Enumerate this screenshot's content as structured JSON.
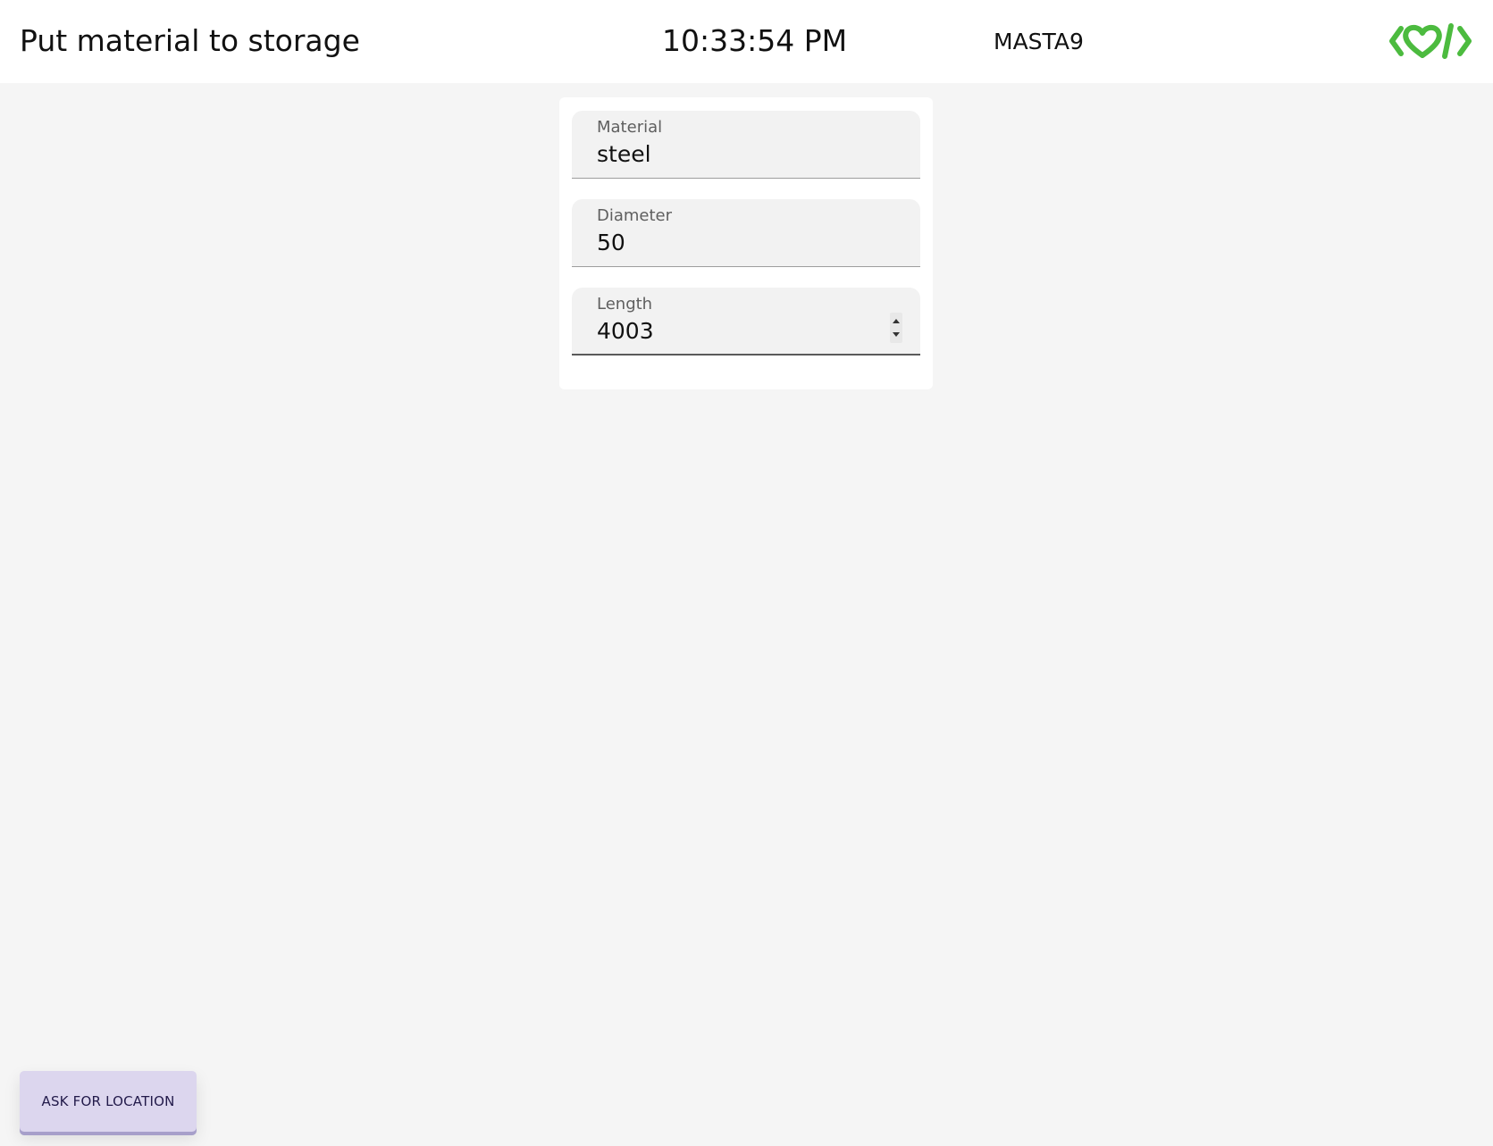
{
  "header": {
    "title": "Put material to storage",
    "clock": "10:33:54 PM",
    "station": "MASTA9",
    "logo_icon": "heart-code-logo-icon",
    "logo_color": "#4cbb3f"
  },
  "form": {
    "material": {
      "label": "Material",
      "value": "steel"
    },
    "diameter": {
      "label": "Diameter",
      "value": "50"
    },
    "length": {
      "label": "Length",
      "value": "4003"
    }
  },
  "actions": {
    "ask_location_label": "ASK FOR LOCATION"
  },
  "colors": {
    "background": "#f5f5f5",
    "button_bg": "#dcd6ee",
    "button_text": "#221a4a"
  }
}
